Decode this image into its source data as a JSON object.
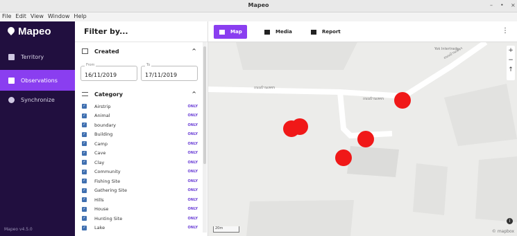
{
  "window": {
    "title": "Mapeo",
    "controls": [
      "–",
      "•",
      "×"
    ]
  },
  "menu": [
    "File",
    "Edit",
    "View",
    "Window",
    "Help"
  ],
  "sidebar": {
    "brand": "Mapeo",
    "items": [
      {
        "label": "Territory",
        "active": false
      },
      {
        "label": "Observations",
        "active": true
      },
      {
        "label": "Synchronize",
        "active": false
      }
    ],
    "version": "Mapeo v4.5.0"
  },
  "filter": {
    "title": "Filter by...",
    "created": {
      "title": "Created",
      "chevron": "^",
      "from_label": "From",
      "from_value": "16/11/2019",
      "to_label": "To",
      "to_value": "17/11/2019"
    },
    "category": {
      "title": "Category",
      "chevron": "^",
      "only_label": "ONLY",
      "items": [
        "Airstrip",
        "Animal",
        "boundary",
        "Building",
        "Camp",
        "Cave",
        "Clay",
        "Community",
        "Fishing Site",
        "Gathering Site",
        "Hills",
        "House",
        "Hunting Site",
        "Lake"
      ]
    }
  },
  "toolbar": {
    "tabs": [
      {
        "label": "Map",
        "active": true
      },
      {
        "label": "Media",
        "active": false
      },
      {
        "label": "Report",
        "active": false
      }
    ],
    "menu": "⋮"
  },
  "map": {
    "labels": [
      "ถนนบ้านเพชร",
      "ถนนบ้านเพชร",
      "ถนนบ้านเพชร",
      "Yok Intertrade"
    ],
    "zoom_in": "+",
    "zoom_out": "−",
    "compass": "↑",
    "info": "i",
    "scale": "20m",
    "attribution": "© mapbox",
    "marker_color": "#f01818"
  },
  "colors": {
    "sidebar": "#210f3f",
    "accent": "#8a3ef0",
    "checkbox": "#3f6fb0",
    "only": "#6b3fd6"
  }
}
